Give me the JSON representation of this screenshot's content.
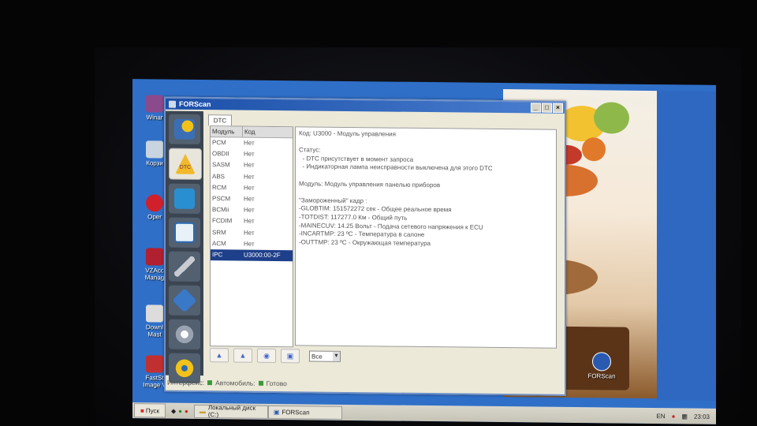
{
  "window": {
    "title": "FORScan",
    "buttons": [
      "_",
      "□",
      "×"
    ]
  },
  "toolbar": {
    "tools": [
      {
        "icon": "vehicle-info-icon"
      },
      {
        "icon": "dtc-icon",
        "label": "DTC"
      },
      {
        "icon": "oscilloscope-icon"
      },
      {
        "icon": "checklist-icon"
      },
      {
        "icon": "wrench-icon"
      },
      {
        "icon": "chip-icon"
      },
      {
        "icon": "settings-icon"
      },
      {
        "icon": "steering-wheel-icon"
      }
    ]
  },
  "tab": {
    "label": "DTC"
  },
  "modules": {
    "header": {
      "module": "Модуль",
      "code": "Код"
    },
    "rows": [
      {
        "module": "PCM",
        "code": "Нет"
      },
      {
        "module": "OBDII",
        "code": "Нет"
      },
      {
        "module": "SASM",
        "code": "Нет"
      },
      {
        "module": "ABS",
        "code": "Нет"
      },
      {
        "module": "RCM",
        "code": "Нет"
      },
      {
        "module": "PSCM",
        "code": "Нет"
      },
      {
        "module": "BCMii",
        "code": "Нет"
      },
      {
        "module": "FCDIM",
        "code": "Нет"
      },
      {
        "module": "SRM",
        "code": "Нет"
      },
      {
        "module": "ACM",
        "code": "Нет"
      },
      {
        "module": "IPC",
        "code": "U3000:00-2F",
        "selected": true
      }
    ]
  },
  "details": {
    "lines": [
      "Код: U3000 - Модуль управления",
      "",
      "Статус:",
      "  - DTC присутствует в момент запроса",
      "  - Индикаторная лампа неисправности выключена для этого DTC",
      "",
      "Модуль: Модуль управления панелью приборов",
      "",
      "\"Замороженный\" кадр :",
      "-GLOBTIM: 151572272 сек - Общее реальное время",
      "-TOTDIST: 117277.0 Км - Общий путь",
      "-MAINECUV: 14.25 Вольт - Подача сетевого напряжения к ECU",
      "-INCARTMP: 23 ºC - Температура в салоне",
      "-OUTTMP: 23 ºC - Окружающая температура"
    ]
  },
  "filter": {
    "value": "Все"
  },
  "status": {
    "interface_label": "Интерфейс:",
    "vehicle_label": "Автомобиль:",
    "vehicle_value": "Готово"
  },
  "desktop_icons": [
    {
      "label": "Winar"
    },
    {
      "label": "Корзи"
    },
    {
      "label": "Oper"
    },
    {
      "label": "VZAcc Manag"
    },
    {
      "label": "Downl Mast"
    },
    {
      "label": "FastSt Image V"
    },
    {
      "label": "FORScan"
    }
  ],
  "taskbar": {
    "start_label": "Пуск",
    "items": [
      "Локальный диск (C:)",
      "FORScan"
    ],
    "lang": "EN",
    "clock": "23:03"
  }
}
